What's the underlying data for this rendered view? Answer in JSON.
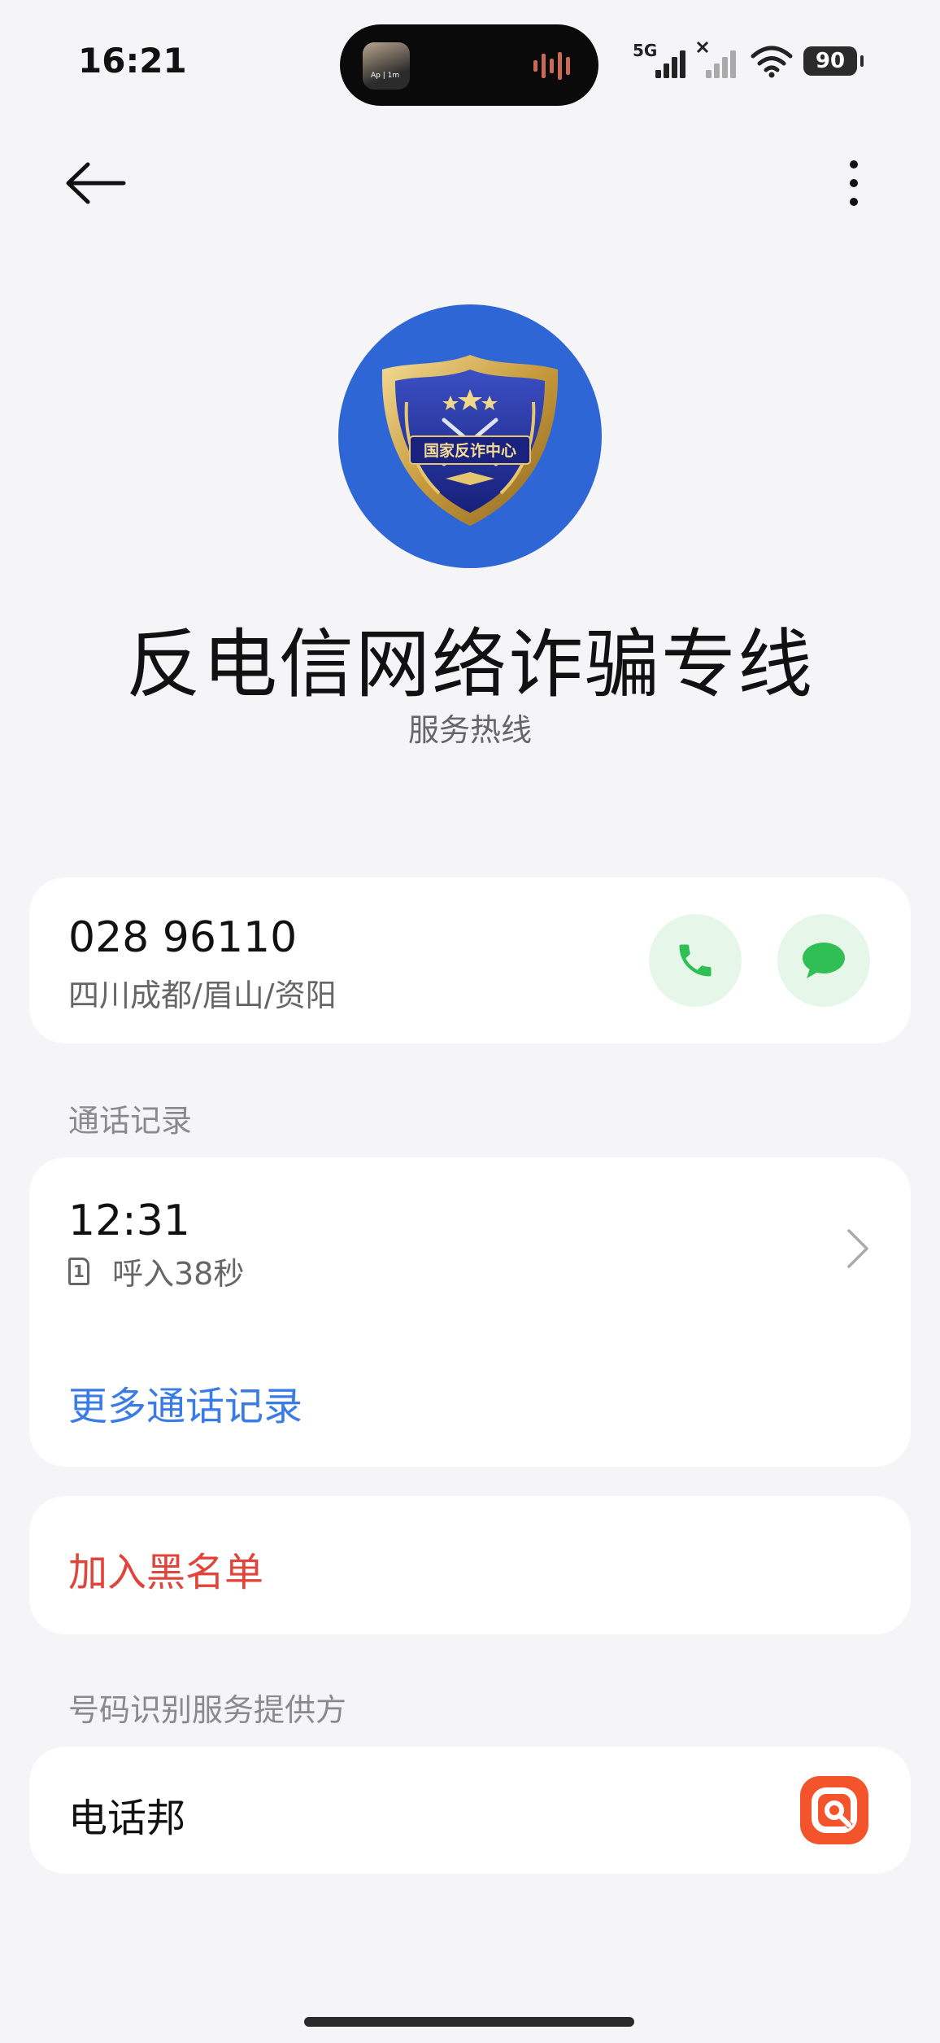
{
  "status_bar": {
    "time": "16:21",
    "network_label": "5G",
    "battery": "90",
    "icons": [
      "signal-icon",
      "signal-no-service-icon",
      "wifi-icon",
      "battery-icon"
    ]
  },
  "island": {
    "thumbnail_text": "Ap | 1m",
    "icon": "audio-wave-icon",
    "accent": "#c96a55"
  },
  "nav": {
    "back_icon": "arrow-left-icon",
    "more_icon": "more-vertical-icon"
  },
  "avatar": {
    "emblem_text": "国家反诈中心",
    "background": "#2f66d6"
  },
  "contact": {
    "name": "反电信网络诈骗专线",
    "tag": "服务热线"
  },
  "phone": {
    "number": "028 96110",
    "location": "四川成都/眉山/资阳",
    "call_icon": "phone-icon",
    "message_icon": "message-icon",
    "action_color": "#2fbf55",
    "action_bg": "#e6f7ea"
  },
  "call_log": {
    "section_title": "通话记录",
    "entries": [
      {
        "time": "12:31",
        "sim": "1",
        "detail": "呼入38秒"
      }
    ],
    "more_label": "更多通话记录",
    "link_color": "#3b7be6"
  },
  "blacklist": {
    "label": "加入黑名单",
    "color": "#e0443a"
  },
  "provider": {
    "section_title": "号码识别服务提供方",
    "name": "电话邦",
    "logo_color": "#f3542c"
  }
}
